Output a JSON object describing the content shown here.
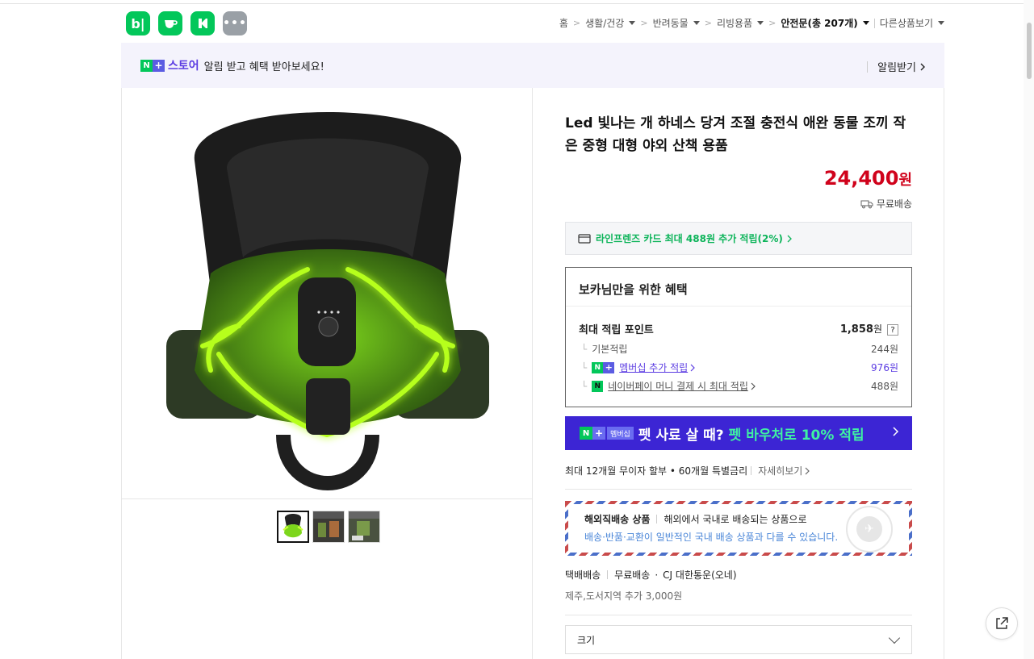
{
  "header": {
    "apps": [
      {
        "icon": "blog-icon",
        "label": "b|"
      },
      {
        "icon": "cafe-icon",
        "label": ""
      },
      {
        "icon": "kstore-icon",
        "label": ""
      },
      {
        "icon": "more-icon",
        "label": "•••"
      }
    ],
    "breadcrumb": {
      "home": "홈",
      "c1": "생활/건강",
      "c2": "반려동물",
      "c3": "리빙용품",
      "c4": "안전문(총 207개)",
      "other": "다른상품보기"
    }
  },
  "banner": {
    "n": "N",
    "plus": "+",
    "brand": "스토어",
    "text": "알림 받고 혜택 받아보세요!",
    "action": "알림받기"
  },
  "product": {
    "title": "Led 빛나는 개 하네스 당겨 조절 충전식 애완 동물 조끼 작은 중형 대형 야외 산책 용품",
    "price": "24,400",
    "currency": "원",
    "shipping": "무료배송",
    "card": "라인프렌즈 카드 최대 488원 추가 적립(2%)"
  },
  "benefit": {
    "title": "보카님만을 위한 혜택",
    "max_label": "최대 적립 포인트",
    "max_value": "1,858",
    "max_unit": "원",
    "q": "?",
    "basic_label": "기본적립",
    "basic_value": "244원",
    "member_label": "멤버십 추가 적립",
    "member_value": "976원",
    "npay_label": "네이버페이 머니 결제 시 최대 적립",
    "npay_value": "488원"
  },
  "promo": {
    "badge": "멤버십",
    "text": "펫 사료 살 때?",
    "highlight": "펫 바우처로 10% 적립"
  },
  "installment": {
    "text": "최대 12개월 무이자 할부 • 60개월 특별금리",
    "detail": "자세히보기"
  },
  "overseas": {
    "title": "해외직배송 상품",
    "desc": "해외에서 국내로 배송되는 상품으로",
    "note": "배송·반품·교환이 일반적인 국내 배송 상품과 다를 수 있습니다."
  },
  "delivery": {
    "method": "택배배송",
    "fee": "무료배송",
    "carrier": "CJ 대한통운(오네)",
    "extra": "제주,도서지역 추가 3,000원"
  },
  "option": {
    "label": "크기"
  },
  "colors": {
    "naver_green": "#03c75a",
    "price_red": "#d0021b",
    "promo_blue": "#3c25d4",
    "membership_purple": "#5b3ce2"
  }
}
